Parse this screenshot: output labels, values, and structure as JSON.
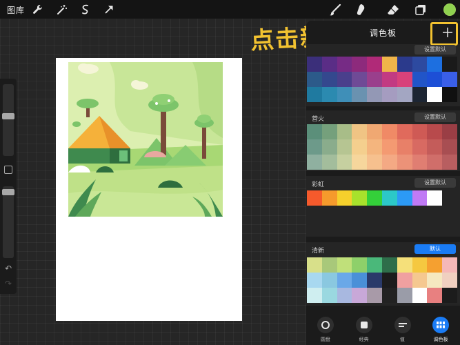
{
  "topbar": {
    "gallery_label": "图库",
    "left_tools": [
      {
        "icon": "wrench-icon"
      },
      {
        "icon": "magic-wand-icon"
      },
      {
        "icon": "selection-icon"
      },
      {
        "icon": "transform-arrow-icon"
      }
    ],
    "right_tools": [
      {
        "icon": "brush-icon"
      },
      {
        "icon": "smudge-icon"
      },
      {
        "icon": "eraser-icon"
      },
      {
        "icon": "layers-icon"
      }
    ],
    "current_color": "#8fd14f"
  },
  "sidebar": {
    "undo_icon": "↶",
    "redo_icon": "↷"
  },
  "annotation": {
    "text": "点击新建",
    "color": "#f2c230"
  },
  "panel": {
    "title": "调色板",
    "add_icon": "plus-icon"
  },
  "palettes": [
    {
      "name": "",
      "default_label": "设置默认",
      "is_default": false,
      "colors": [
        "#3b2f7a",
        "#5a2d86",
        "#762b85",
        "#8d2a7c",
        "#b02a78",
        "#f0b54a",
        "#2b3a8c",
        "#2d4aa0",
        "#1d6fe0",
        "#1a1a1a",
        "#2c5a8a",
        "#34488e",
        "#4a3f8c",
        "#6f4a96",
        "#9a3f8c",
        "#c23a82",
        "#d8427a",
        "#2155c8",
        "#1d4fd6",
        "#3a5fe8",
        "#1f7aa0",
        "#2b8ab0",
        "#3f8fb8",
        "#6a92b0",
        "#9398b5",
        "#a59cc0",
        "#a3a6c2",
        "#1c2533",
        "#ffffff",
        "#101010"
      ]
    },
    {
      "name": "营火",
      "default_label": "设置默认",
      "is_default": false,
      "colors": [
        "#5b8f7a",
        "#75a07c",
        "#a8bd88",
        "#f0c484",
        "#f0a872",
        "#f08a66",
        "#e06a5c",
        "#cf5a55",
        "#b84a4c",
        "#9a3e45",
        "#6d9a8a",
        "#8aac8c",
        "#b6c592",
        "#f4cf8e",
        "#f4b57e",
        "#f49a72",
        "#e88068",
        "#d86a62",
        "#c45c5a",
        "#a84e52",
        "#8fb0a0",
        "#a3bd9c",
        "#c6d0a0",
        "#f6d69c",
        "#f6c08e",
        "#f4a984",
        "#ec9278",
        "#e07e72",
        "#d06e6a",
        "#b85e60"
      ]
    },
    {
      "name": "彩虹",
      "default_label": "设置默认",
      "is_default": false,
      "colors": [
        "#f55a2c",
        "#f59a2c",
        "#f5d02c",
        "#a8e22c",
        "#34d03a",
        "#2cc8c8",
        "#2c9af5",
        "#c07af5",
        "#ffffff",
        "#252525"
      ]
    },
    {
      "name": "清新",
      "default_label": "默认",
      "is_default": true,
      "colors": [
        "#d8e08a",
        "#a8c87a",
        "#c0e07a",
        "#8ed06a",
        "#4ab87a",
        "#2e6e4a",
        "#f5e07a",
        "#f5c840",
        "#f5a030",
        "#f5b8b8",
        "#a8d8f0",
        "#8ac8e0",
        "#6aa8e8",
        "#4a90d8",
        "#2a3a6a",
        "#1c1c1c",
        "#f0a0a0",
        "#f5c890",
        "#f5e8c0",
        "#f0d0c0",
        "#cfeef0",
        "#9ad8e0",
        "#a8b8e0",
        "#c8a8d8",
        "#a89aa8",
        "#222222",
        "#9a9ca8",
        "#ffffff",
        "#e88080",
        "#1c1c1c"
      ]
    }
  ],
  "tabs": [
    {
      "label": "圆盘",
      "icon": "disc-icon",
      "active": false
    },
    {
      "label": "经典",
      "icon": "classic-square-icon",
      "active": false
    },
    {
      "label": "值",
      "icon": "value-bars-icon",
      "active": false
    },
    {
      "label": "调色板",
      "icon": "palette-grid-icon",
      "active": true
    }
  ]
}
